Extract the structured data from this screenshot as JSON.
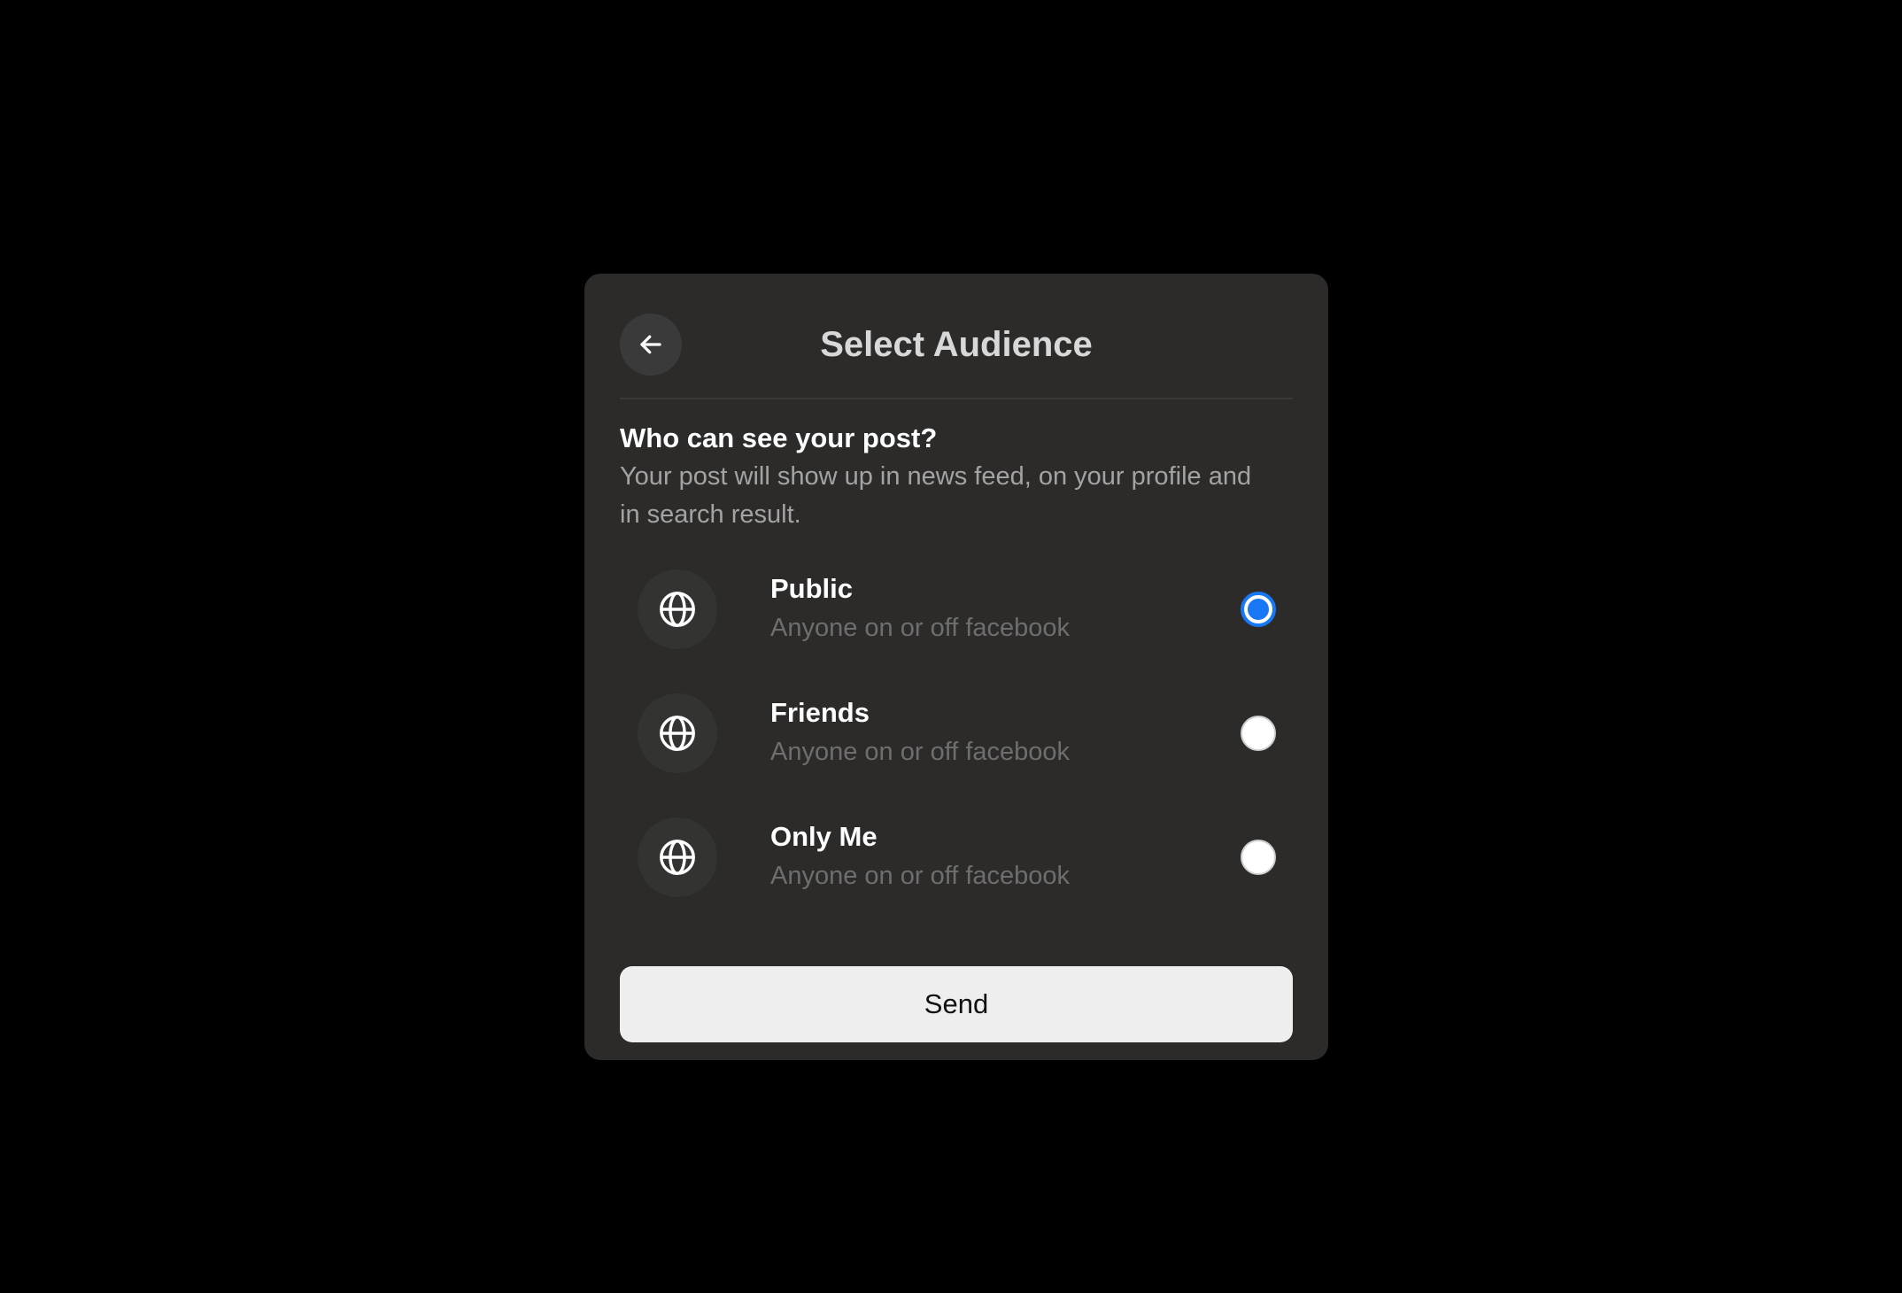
{
  "header": {
    "title": "Select Audience",
    "back_icon": "arrow-left-icon"
  },
  "intro": {
    "question": "Who can see your post?",
    "description": "Your post will show up in news feed, on your profile and in search result."
  },
  "options": [
    {
      "label": "Public",
      "subtitle": "Anyone on or off facebook",
      "icon": "globe-icon",
      "selected": true
    },
    {
      "label": "Friends",
      "subtitle": "Anyone on or off facebook",
      "icon": "globe-icon",
      "selected": false
    },
    {
      "label": "Only Me",
      "subtitle": "Anyone on or off facebook",
      "icon": "globe-icon",
      "selected": false
    }
  ],
  "actions": {
    "send_label": "Send"
  },
  "colors": {
    "page_background": "#000000",
    "dialog_background": "#2c2b2a",
    "accent": "#1877f2",
    "button_background": "#eeeeee"
  }
}
